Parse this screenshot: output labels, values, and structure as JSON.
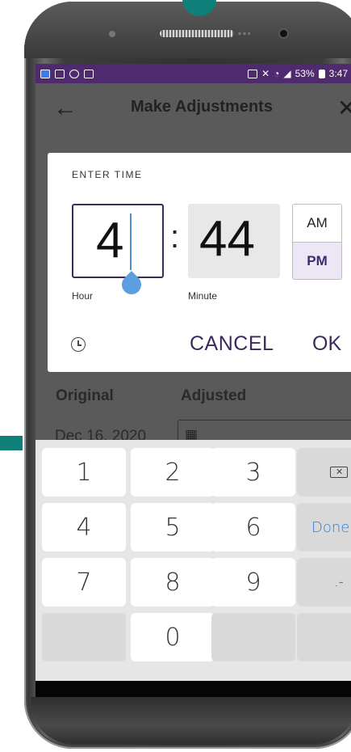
{
  "status_bar": {
    "battery": "53%",
    "time": "3:47"
  },
  "app_bar": {
    "title": "Make Adjustments"
  },
  "background": {
    "original_label": "Original",
    "adjusted_label": "Adjusted",
    "original_date": "Dec 16, 2020"
  },
  "dialog": {
    "title": "ENTER TIME",
    "hour": "4",
    "minute": "44",
    "hour_label": "Hour",
    "minute_label": "Minute",
    "am": "AM",
    "pm": "PM",
    "selected_period": "PM",
    "cancel": "CANCEL",
    "ok": "OK"
  },
  "keyboard": {
    "rows": [
      [
        "1",
        "2",
        "3",
        "⌫"
      ],
      [
        "4",
        "5",
        "6",
        "Done"
      ],
      [
        "7",
        "8",
        "9",
        ".-"
      ],
      [
        "",
        "0",
        "",
        ""
      ]
    ]
  },
  "colors": {
    "accent": "#4f2a6e",
    "teal": "#0e7f79",
    "caret": "#4d8fd6"
  }
}
